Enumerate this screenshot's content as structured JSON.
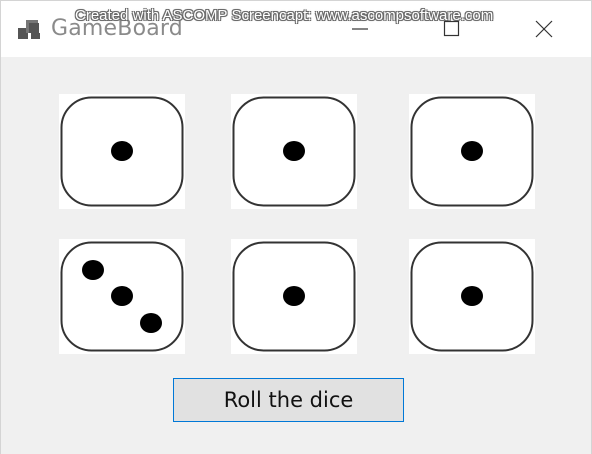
{
  "window": {
    "title": "GameBoard",
    "watermark": "Created with ASCOMP Screencapt: www.ascompsoftware.com",
    "icons": {
      "app": "app-window-icon",
      "minimize": "minimize-icon",
      "maximize": "maximize-icon",
      "close": "close-icon"
    }
  },
  "dice": [
    {
      "value": 1
    },
    {
      "value": 1
    },
    {
      "value": 1
    },
    {
      "value": 3
    },
    {
      "value": 1
    },
    {
      "value": 1
    }
  ],
  "roll_button": {
    "label": "Roll the dice"
  },
  "colors": {
    "accent": "#0078d7",
    "button_face": "#e1e1e1",
    "window_bg": "#f0f0f0"
  }
}
